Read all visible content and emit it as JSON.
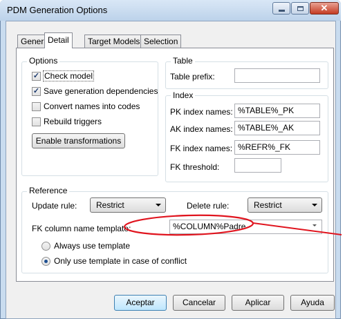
{
  "window": {
    "title": "PDM Generation Options"
  },
  "tabs": [
    {
      "label": "General"
    },
    {
      "label": "Detail"
    },
    {
      "label": "Target Models"
    },
    {
      "label": "Selection"
    }
  ],
  "options_group": {
    "title": "Options",
    "check_model": {
      "label": "Check model",
      "checked": true
    },
    "save_dependencies": {
      "label": "Save generation dependencies",
      "checked": true
    },
    "convert_names": {
      "label": "Convert names into codes",
      "checked": false
    },
    "rebuild_triggers": {
      "label": "Rebuild triggers",
      "checked": false
    },
    "enable_transformations": "Enable transformations"
  },
  "table_group": {
    "title": "Table",
    "prefix_label": "Table prefix:",
    "prefix_value": ""
  },
  "index_group": {
    "title": "Index",
    "pk_label": "PK index names:",
    "pk_value": "%TABLE%_PK",
    "ak_label": "AK index names:",
    "ak_value": "%TABLE%_AK",
    "fk_label": "FK index names:",
    "fk_value": "%REFR%_FK",
    "threshold_label": "FK threshold:",
    "threshold_value": ""
  },
  "reference_group": {
    "title": "Reference",
    "update_rule_label": "Update rule:",
    "update_rule_value": "Restrict",
    "delete_rule_label": "Delete rule:",
    "delete_rule_value": "Restrict",
    "fk_template_label": "FK column name template:",
    "fk_template_value": "%COLUMN%Padre",
    "always_template": {
      "label": "Always use template",
      "selected": false
    },
    "only_conflict": {
      "label": "Only use template in case of conflict",
      "selected": true
    }
  },
  "footer": {
    "accept": "Aceptar",
    "cancel": "Cancelar",
    "apply": "Aplicar",
    "help": "Ayuda"
  },
  "colors": {
    "annotation": "#e0141e",
    "accent": "#3c7fb1"
  }
}
